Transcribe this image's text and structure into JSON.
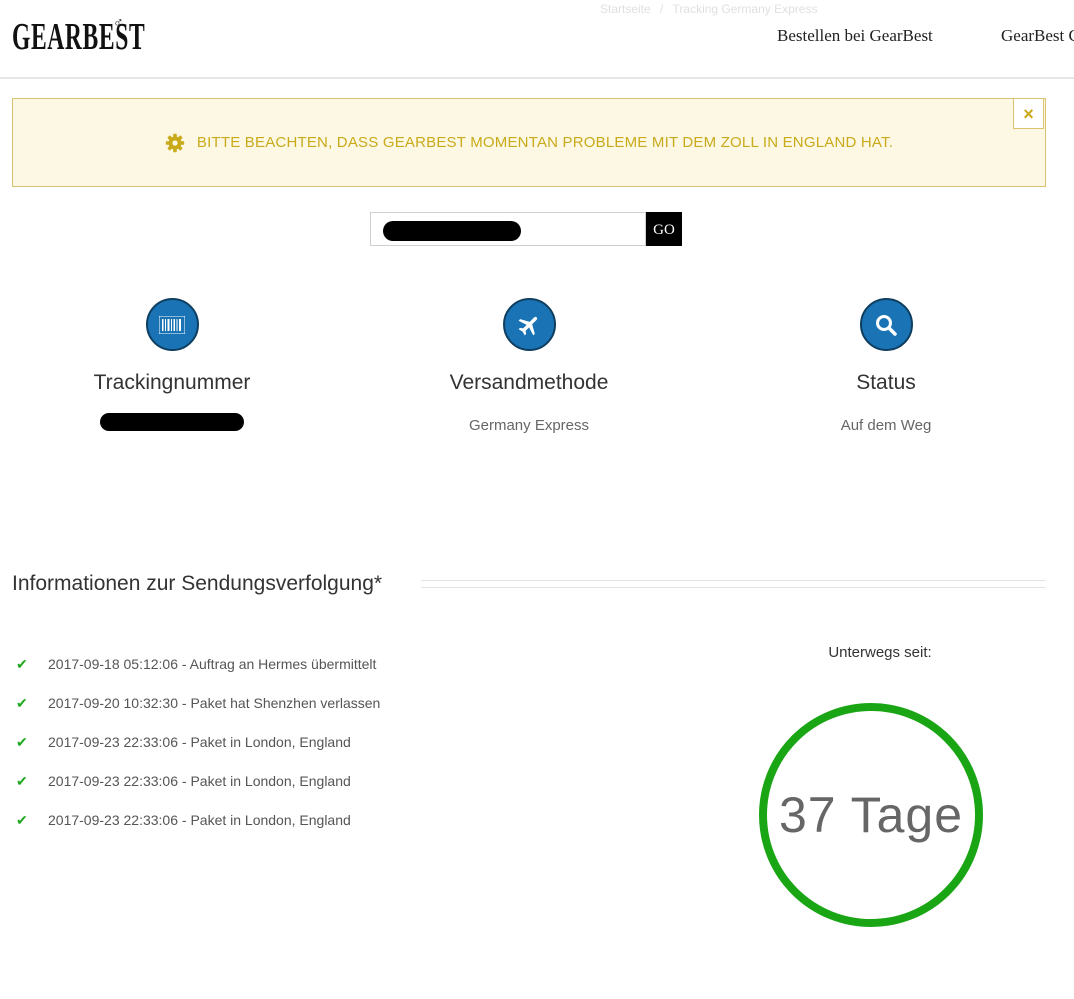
{
  "header": {
    "logo_text": "GEARBEST",
    "breadcrumb": [
      "Startseite",
      "/",
      "Tracking Germany Express"
    ],
    "nav": [
      "Bestellen bei GearBest",
      "GearBest G"
    ]
  },
  "banner": {
    "text": "BITTE BEACHTEN, DASS GEARBEST MOMENTAN PROBLEME MIT DEM ZOLL IN ENGLAND HAT.",
    "icon": "gear-icon",
    "close_label": "×"
  },
  "search": {
    "value": "",
    "button_label": "GO"
  },
  "info_columns": [
    {
      "icon": "barcode-icon",
      "title": "Trackingnummer",
      "value": ""
    },
    {
      "icon": "airplane-icon",
      "title": "Versandmethode",
      "value": "Germany Express"
    },
    {
      "icon": "search-icon",
      "title": "Status",
      "value": "Auf dem Weg"
    }
  ],
  "tracking": {
    "section_title": "Informationen zur Sendungsverfolgung*",
    "events": [
      "2017-09-18 05:12:06 - Auftrag an Hermes übermittelt",
      "2017-09-20 10:32:30 - Paket hat Shenzhen verlassen",
      "2017-09-23 22:33:06 - Paket in London, England",
      "2017-09-23 22:33:06 - Paket in London, England",
      "2017-09-23 22:33:06 - Paket in London, England"
    ],
    "transit_label": "Unterwegs seit:",
    "transit_value": "37 Tage"
  },
  "colors": {
    "banner_bg": "#fcf8e3",
    "banner_text": "#c9aa1a",
    "icon_blue": "#1a73b4",
    "check_green": "#1ea81e",
    "ring_green": "#1aa614"
  }
}
